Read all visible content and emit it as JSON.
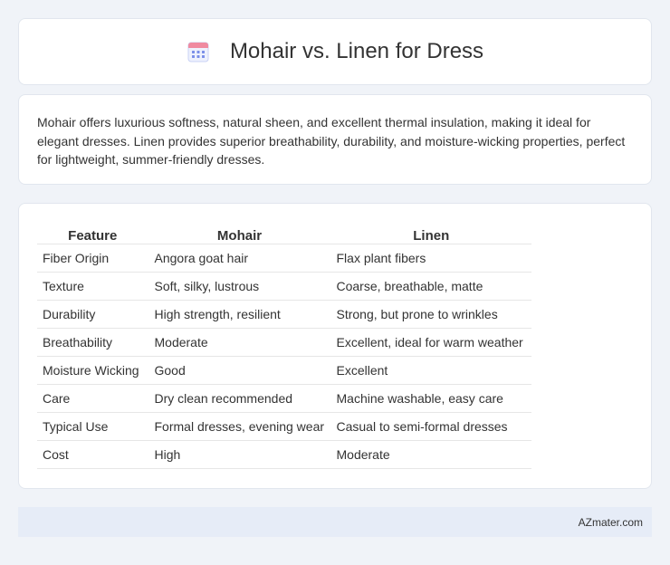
{
  "header": {
    "title": "Mohair vs. Linen for Dress",
    "icon": "calendar-icon"
  },
  "intro": {
    "text": "Mohair offers luxurious softness, natural sheen, and excellent thermal insulation, making it ideal for elegant dresses. Linen provides superior breathability, durability, and moisture-wicking properties, perfect for lightweight, summer-friendly dresses."
  },
  "table": {
    "headers": [
      "Feature",
      "Mohair",
      "Linen"
    ],
    "rows": [
      [
        "Fiber Origin",
        "Angora goat hair",
        "Flax plant fibers"
      ],
      [
        "Texture",
        "Soft, silky, lustrous",
        "Coarse, breathable, matte"
      ],
      [
        "Durability",
        "High strength, resilient",
        "Strong, but prone to wrinkles"
      ],
      [
        "Breathability",
        "Moderate",
        "Excellent, ideal for warm weather"
      ],
      [
        "Moisture Wicking",
        "Good",
        "Excellent"
      ],
      [
        "Care",
        "Dry clean recommended",
        "Machine washable, easy care"
      ],
      [
        "Typical Use",
        "Formal dresses, evening wear",
        "Casual to semi-formal dresses"
      ],
      [
        "Cost",
        "High",
        "Moderate"
      ]
    ]
  },
  "footer": {
    "brand": "AZmater.com"
  },
  "colors": {
    "background": "#f0f3f8",
    "card": "#ffffff",
    "footer": "#e6ecf7",
    "icon_accent": "#7b8fe8"
  }
}
